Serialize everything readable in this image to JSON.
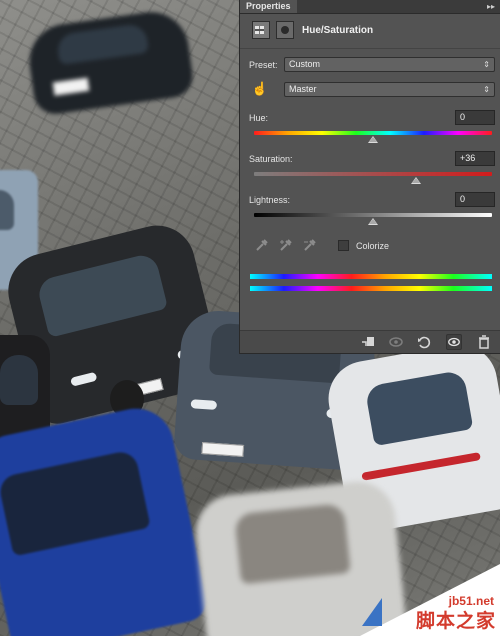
{
  "panel": {
    "tab_label": "Properties",
    "collapse_glyph": "▸▸",
    "adjustment_title": "Hue/Saturation",
    "preset_label": "Preset:",
    "preset_value": "Custom",
    "channel_value": "Master",
    "hue": {
      "label": "Hue:",
      "value": "0",
      "level": 0.5
    },
    "saturation": {
      "label": "Saturation:",
      "value": "+36",
      "level": 0.68
    },
    "lightness": {
      "label": "Lightness:",
      "value": "0",
      "level": 0.5
    },
    "colorize_label": "Colorize",
    "colorize_checked": false,
    "icons": {
      "adjustment": "adjustment-layer-icon",
      "mask": "mask-icon",
      "hand": "targeted-adjustment-hand-icon",
      "eyedropper": "eyedropper-icon",
      "eyedropper_plus": "eyedropper-plus-icon",
      "eyedropper_minus": "eyedropper-minus-icon",
      "clip": "clip-to-layer-icon",
      "view_previous": "view-previous-state-icon",
      "reset": "reset-icon",
      "visibility": "eye-icon",
      "delete": "trash-icon"
    }
  },
  "watermark": {
    "domain": "jb51.net",
    "chinese": "脚本之家"
  },
  "colors": {
    "panel_bg": "#535353",
    "saturation_accent": "#d21c1c",
    "watermark_red": "#d33b2d"
  }
}
